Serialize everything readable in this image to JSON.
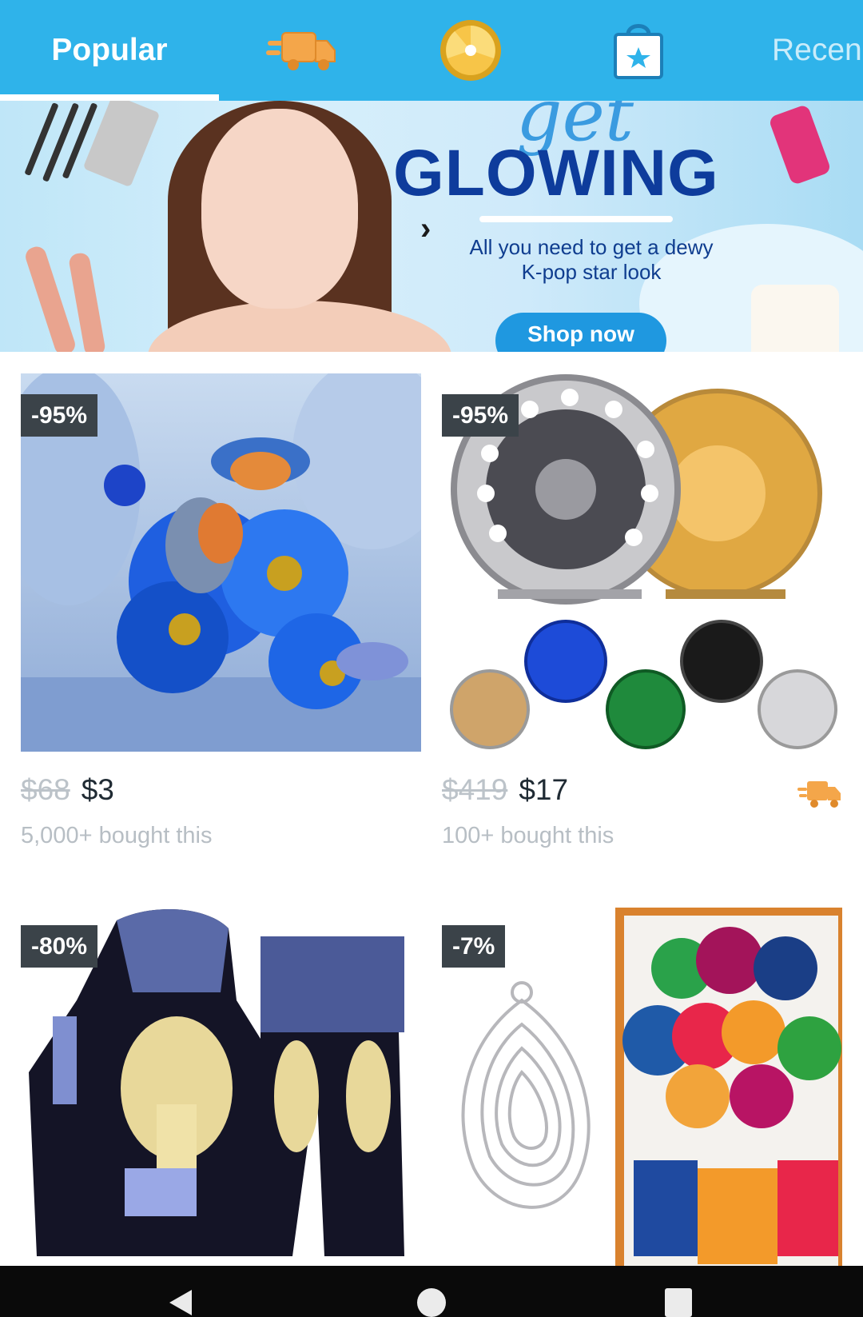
{
  "tabs": {
    "popular": "Popular",
    "recent": "Recen",
    "icons": [
      "delivery-truck-icon",
      "wheel-icon",
      "shopping-bag-icon"
    ]
  },
  "banner": {
    "script_word": "get",
    "headline": "GLOWING",
    "subtitle_line1": "All you need to get a dewy",
    "subtitle_line2": "K-pop star look",
    "cta": "Shop now",
    "accent": "#0e3c9c"
  },
  "products": [
    {
      "discount": "-95%",
      "old_price": "$68",
      "price": "$3",
      "bought": "5,000+ bought this",
      "image": "bluebirds-flowers-painting"
    },
    {
      "discount": "-95%",
      "old_price": "$419",
      "price": "$17",
      "bought": "100+ bought this",
      "image": "fly-fishing-reels",
      "fast_shipping": true
    },
    {
      "discount": "-80%",
      "image": "2pac-hoodie-pants-set"
    },
    {
      "discount": "-7%",
      "image": "cutting-dies-balloons-card"
    }
  ],
  "colors": {
    "header": "#2fb3ea",
    "badge": "#3b4349",
    "old_price": "#bcc3c9",
    "price": "#1f2a33",
    "shipping_icon": "#f4a64a"
  },
  "navbar": {
    "icons": [
      "back-icon",
      "home-icon",
      "recents-icon"
    ]
  }
}
